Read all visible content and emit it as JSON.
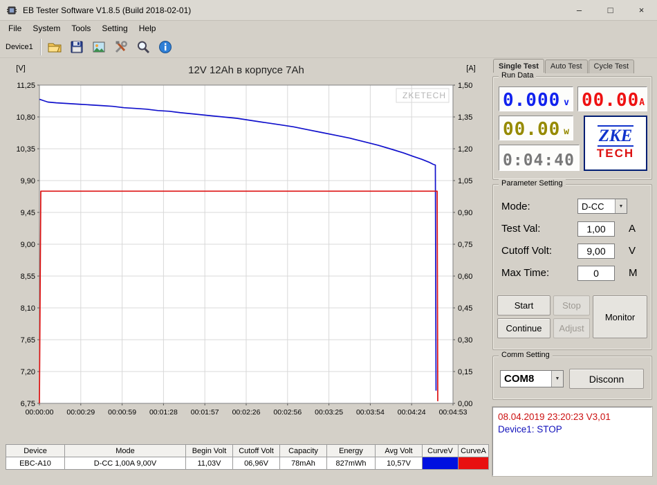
{
  "window": {
    "title": "EB Tester Software V1.8.5 (Build 2018-02-01)",
    "controls": {
      "minimize": "–",
      "maximize": "□",
      "close": "×"
    }
  },
  "menu": {
    "items": [
      "File",
      "System",
      "Tools",
      "Setting",
      "Help"
    ]
  },
  "toolbar": {
    "device_label": "Device1"
  },
  "icons": {
    "chevron_down": "▼"
  },
  "chart_data": {
    "type": "line",
    "title": "12V 12Ah в корпусе 7Ah",
    "watermark": "ZKETECH",
    "y_left": {
      "unit": "[V]",
      "min": 6.75,
      "max": 11.25,
      "ticks": [
        "11,25",
        "10,80",
        "10,35",
        "9,90",
        "9,45",
        "9,00",
        "8,55",
        "8,10",
        "7,65",
        "7,20",
        "6,75"
      ]
    },
    "y_right": {
      "unit": "[A]",
      "min": 0.0,
      "max": 1.5,
      "ticks": [
        "1,50",
        "1,35",
        "1,20",
        "1,05",
        "0,90",
        "0,75",
        "0,60",
        "0,45",
        "0,30",
        "0,15",
        "0,00"
      ]
    },
    "x": {
      "total_seconds": 293,
      "ticks": [
        "00:00:00",
        "00:00:29",
        "00:00:59",
        "00:01:28",
        "00:01:57",
        "00:02:26",
        "00:02:56",
        "00:03:25",
        "00:03:54",
        "00:04:24",
        "00:04:53"
      ]
    },
    "grid": true,
    "series": [
      {
        "name": "Voltage",
        "axis": "left",
        "color": "#1111cc",
        "points": [
          [
            0,
            11.05
          ],
          [
            3,
            11.03
          ],
          [
            6,
            11.01
          ],
          [
            12,
            11.0
          ],
          [
            20,
            10.99
          ],
          [
            28,
            10.98
          ],
          [
            36,
            10.97
          ],
          [
            44,
            10.96
          ],
          [
            52,
            10.95
          ],
          [
            60,
            10.93
          ],
          [
            68,
            10.92
          ],
          [
            76,
            10.91
          ],
          [
            84,
            10.89
          ],
          [
            92,
            10.88
          ],
          [
            100,
            10.86
          ],
          [
            110,
            10.84
          ],
          [
            120,
            10.82
          ],
          [
            130,
            10.8
          ],
          [
            140,
            10.78
          ],
          [
            150,
            10.75
          ],
          [
            160,
            10.72
          ],
          [
            170,
            10.69
          ],
          [
            180,
            10.66
          ],
          [
            190,
            10.62
          ],
          [
            200,
            10.58
          ],
          [
            210,
            10.54
          ],
          [
            220,
            10.5
          ],
          [
            230,
            10.45
          ],
          [
            240,
            10.4
          ],
          [
            250,
            10.34
          ],
          [
            258,
            10.29
          ],
          [
            265,
            10.24
          ],
          [
            271,
            10.2
          ],
          [
            276,
            10.16
          ],
          [
            279,
            10.13
          ],
          [
            280.5,
            10.12
          ],
          [
            281,
            6.93
          ]
        ]
      },
      {
        "name": "Current",
        "axis": "right",
        "color": "#dd1111",
        "points": [
          [
            0,
            0.0
          ],
          [
            1,
            1.0
          ],
          [
            280.8,
            1.0
          ],
          [
            281.8,
            1.0
          ],
          [
            282.2,
            0.01
          ]
        ]
      }
    ]
  },
  "tabs": {
    "items": [
      "Single Test",
      "Auto Test",
      "Cycle Test"
    ]
  },
  "run_data": {
    "group_label": "Run Data",
    "voltage": {
      "value": "0.000",
      "unit": "v",
      "color": "#1122ee"
    },
    "current": {
      "value": "00.00",
      "unit": "A",
      "color": "#ee1111"
    },
    "power": {
      "value": "00.00",
      "unit": "w",
      "color": "#968a00"
    },
    "time": {
      "value": "0:04:40"
    },
    "logo": {
      "line1": "ZKE",
      "line2": "TECH"
    }
  },
  "parameters": {
    "group_label": "Parameter Setting",
    "mode": {
      "label": "Mode:",
      "value": "D-CC"
    },
    "test_val": {
      "label": "Test Val:",
      "value": "1,00",
      "unit": "A"
    },
    "cutoff": {
      "label": "Cutoff Volt:",
      "value": "9,00",
      "unit": "V"
    },
    "max_time": {
      "label": "Max Time:",
      "value": "0",
      "unit": "M"
    },
    "buttons": {
      "start": "Start",
      "stop": "Stop",
      "continue": "Continue",
      "adjust": "Adjust",
      "monitor": "Monitor"
    }
  },
  "comm": {
    "group_label": "Comm Setting",
    "port": "COM8",
    "disconnect": "Disconn"
  },
  "status": {
    "line1": "08.04.2019 23:20:23  V3,01",
    "line2": "Device1: STOP"
  },
  "bottom_table": {
    "headers": [
      "Device",
      "Mode",
      "Begin Volt",
      "Cutoff Volt",
      "Capacity",
      "Energy",
      "Avg Volt",
      "CurveV",
      "CurveA"
    ],
    "row": {
      "device": "EBC-A10",
      "mode": "D-CC 1,00A 9,00V",
      "begin_volt": "11,03V",
      "cutoff_volt": "06,96V",
      "capacity": "78mAh",
      "energy": "827mWh",
      "avg_volt": "10,57V",
      "curve_v_color": "#0010e0",
      "curve_a_color": "#e81010"
    }
  }
}
